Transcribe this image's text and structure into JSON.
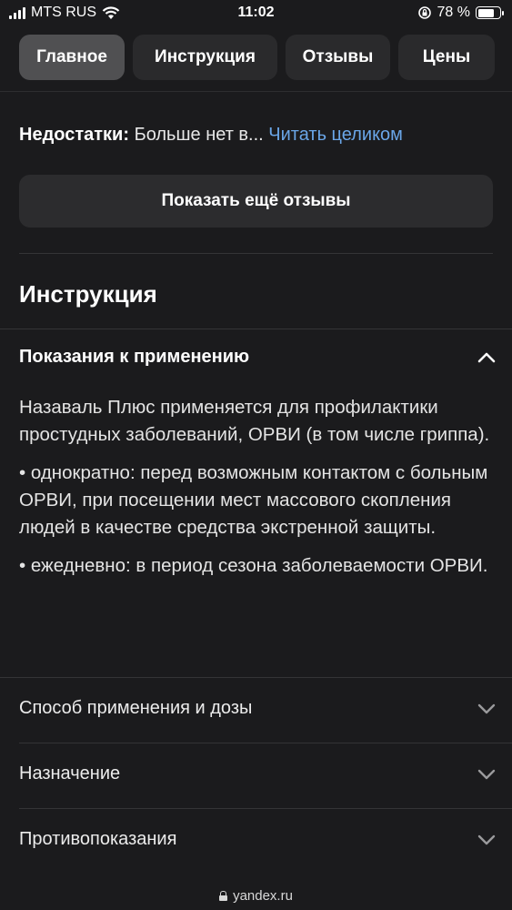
{
  "status_bar": {
    "carrier": "MTS RUS",
    "time": "11:02",
    "battery_percent": "78 %",
    "battery_level": 0.78
  },
  "tabs": [
    {
      "label": "Главное",
      "active": true
    },
    {
      "label": "Инструкция",
      "active": false
    },
    {
      "label": "Отзывы",
      "active": false
    },
    {
      "label": "Цены",
      "active": false
    }
  ],
  "review": {
    "flaw_label": "Недостатки:",
    "flaw_text": " Больше нет в...",
    "read_more": "Читать целиком"
  },
  "more_reviews_button": "Показать ещё отзывы",
  "instruction": {
    "title": "Инструкция",
    "expanded": {
      "title": "Показания к применению",
      "paragraphs": [
        "Назаваль Плюс применяется для профилактики простудных заболеваний, ОРВИ (в том числе гриппа).",
        "• однократно: перед возможным контактом с больным ОРВИ, при посещении мест массового скопления людей в качестве средства экстренной защиты.",
        "• ежедневно: в период сезона заболеваемости ОРВИ."
      ]
    },
    "collapsed": [
      "Способ применения и дозы",
      "Назначение",
      "Противопоказания"
    ]
  },
  "url_bar": {
    "domain": "yandex.ru"
  }
}
